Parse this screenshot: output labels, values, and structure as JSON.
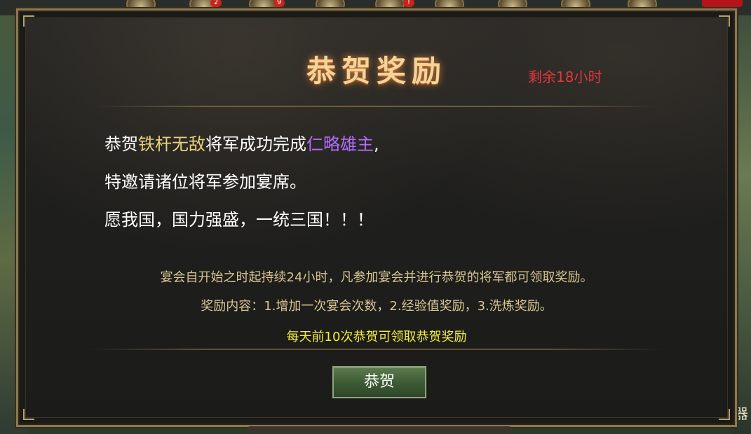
{
  "header_badges": {
    "badge_a": "2",
    "badge_b": "9",
    "badge_c": "!"
  },
  "dialog": {
    "title": "恭贺奖励",
    "remaining": "剩余18小时",
    "message": {
      "line1": {
        "prefix": "恭贺",
        "player": "铁杆无敌",
        "middle": "将军成功完成",
        "achievement": "仁略雄主",
        "suffix": ","
      },
      "line2": "特邀请诸位将军参加宴席。",
      "line3": "愿我国，国力强盛，一统三国！！！"
    },
    "info": {
      "line1": "宴会自开始之时起持续24小时，凡参加宴会并进行恭贺的将军都可领取奖励。",
      "line2": "奖励内容：1.增加一次宴会次数，2.经验值奖励，3.洗炼奖励。",
      "line3": "每天前10次恭贺可领取恭贺奖励"
    },
    "button_label": "恭贺"
  },
  "side_text": "器",
  "colors": {
    "title": "#f4d49a",
    "remaining": "#e2363c",
    "player_name": "#e9d27a",
    "achievement": "#b46cff",
    "info": "#d8c592",
    "info_highlight": "#f2ec3c",
    "button": "#3e5c36"
  }
}
